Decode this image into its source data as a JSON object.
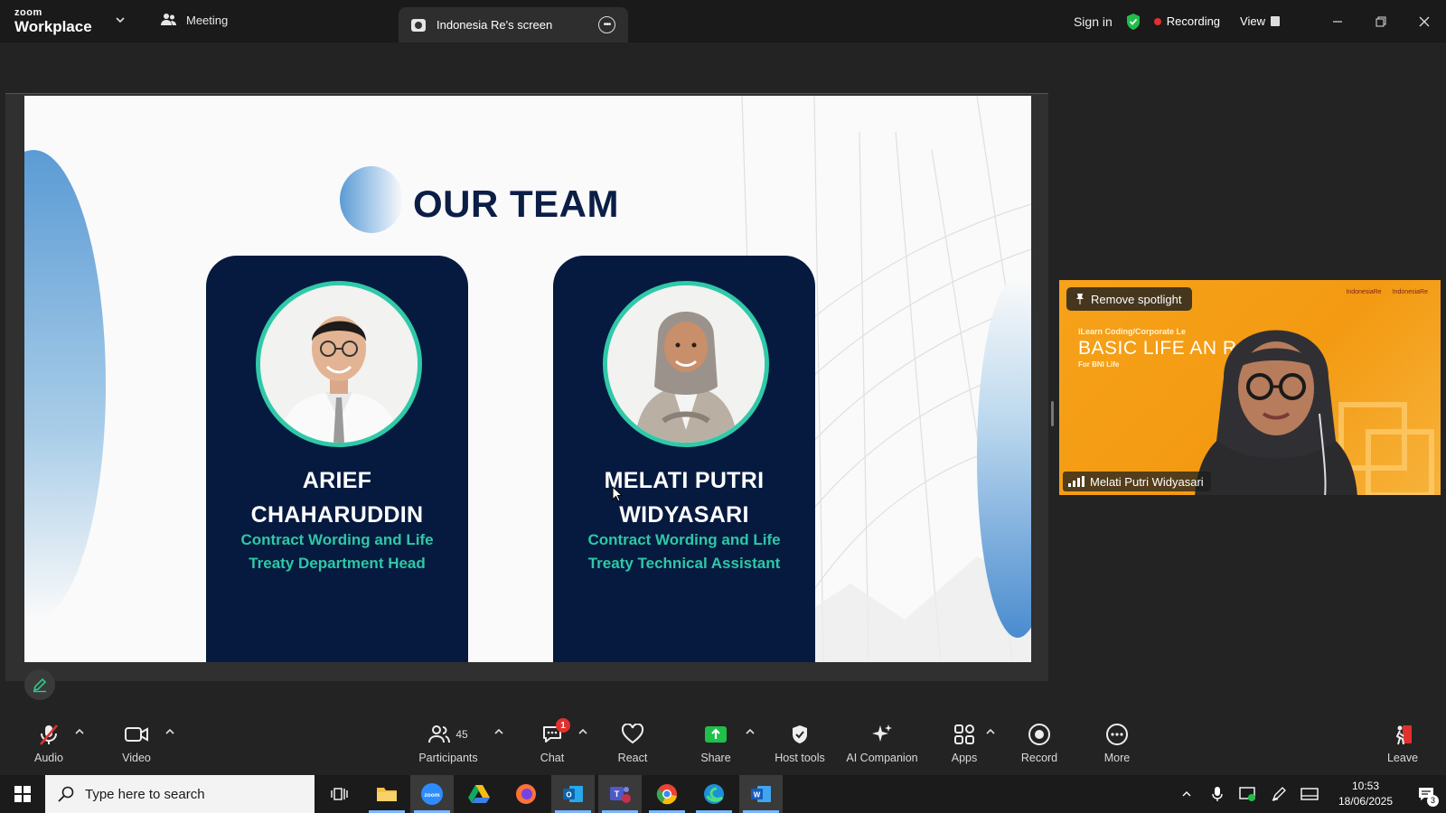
{
  "titlebar": {
    "logo_top": "zoom",
    "logo_bottom": "Workplace",
    "meeting_label": "Meeting",
    "share_tab_label": "Indonesia Re's screen",
    "sign_in": "Sign in",
    "recording": "Recording",
    "view": "View",
    "recording_color": "#e0312d",
    "shield_color": "#1fbf4a"
  },
  "slide": {
    "title": "OUR TEAM",
    "members": [
      {
        "name_line1": "ARIEF",
        "name_line2": "CHAHARUDDIN",
        "role_line1": "Contract Wording and Life",
        "role_line2": "Treaty Department Head"
      },
      {
        "name_line1": "MELATI PUTRI",
        "name_line2": "WIDYASARI",
        "role_line1": "Contract Wording and Life",
        "role_line2": "Treaty Technical Assistant"
      }
    ],
    "card_color": "#061a40",
    "accent_color": "#2ec8a4",
    "title_color": "#0b1e46"
  },
  "video": {
    "spotlight_label": "Remove spotlight",
    "participant_name": "Melati Putri Widyasari",
    "bg_line1": "iLearn Coding/Corporate Le",
    "bg_line2": "BASIC LIFE AN        RAINING",
    "bg_line3": "For BNI Life",
    "bg_logo1": "IndonesiaRe",
    "bg_logo2": "IndonesiaRe"
  },
  "toolbar": {
    "audio": "Audio",
    "video": "Video",
    "participants": "Participants",
    "participants_count": "45",
    "chat": "Chat",
    "chat_badge": "1",
    "react": "React",
    "share": "Share",
    "host_tools": "Host tools",
    "ai_companion": "AI Companion",
    "apps": "Apps",
    "record": "Record",
    "more": "More",
    "leave": "Leave",
    "share_color": "#1fbf4a",
    "leave_color": "#e0312d"
  },
  "taskbar": {
    "search_placeholder": "Type here to search",
    "time": "10:53",
    "date": "18/06/2025",
    "notifications": "3"
  }
}
